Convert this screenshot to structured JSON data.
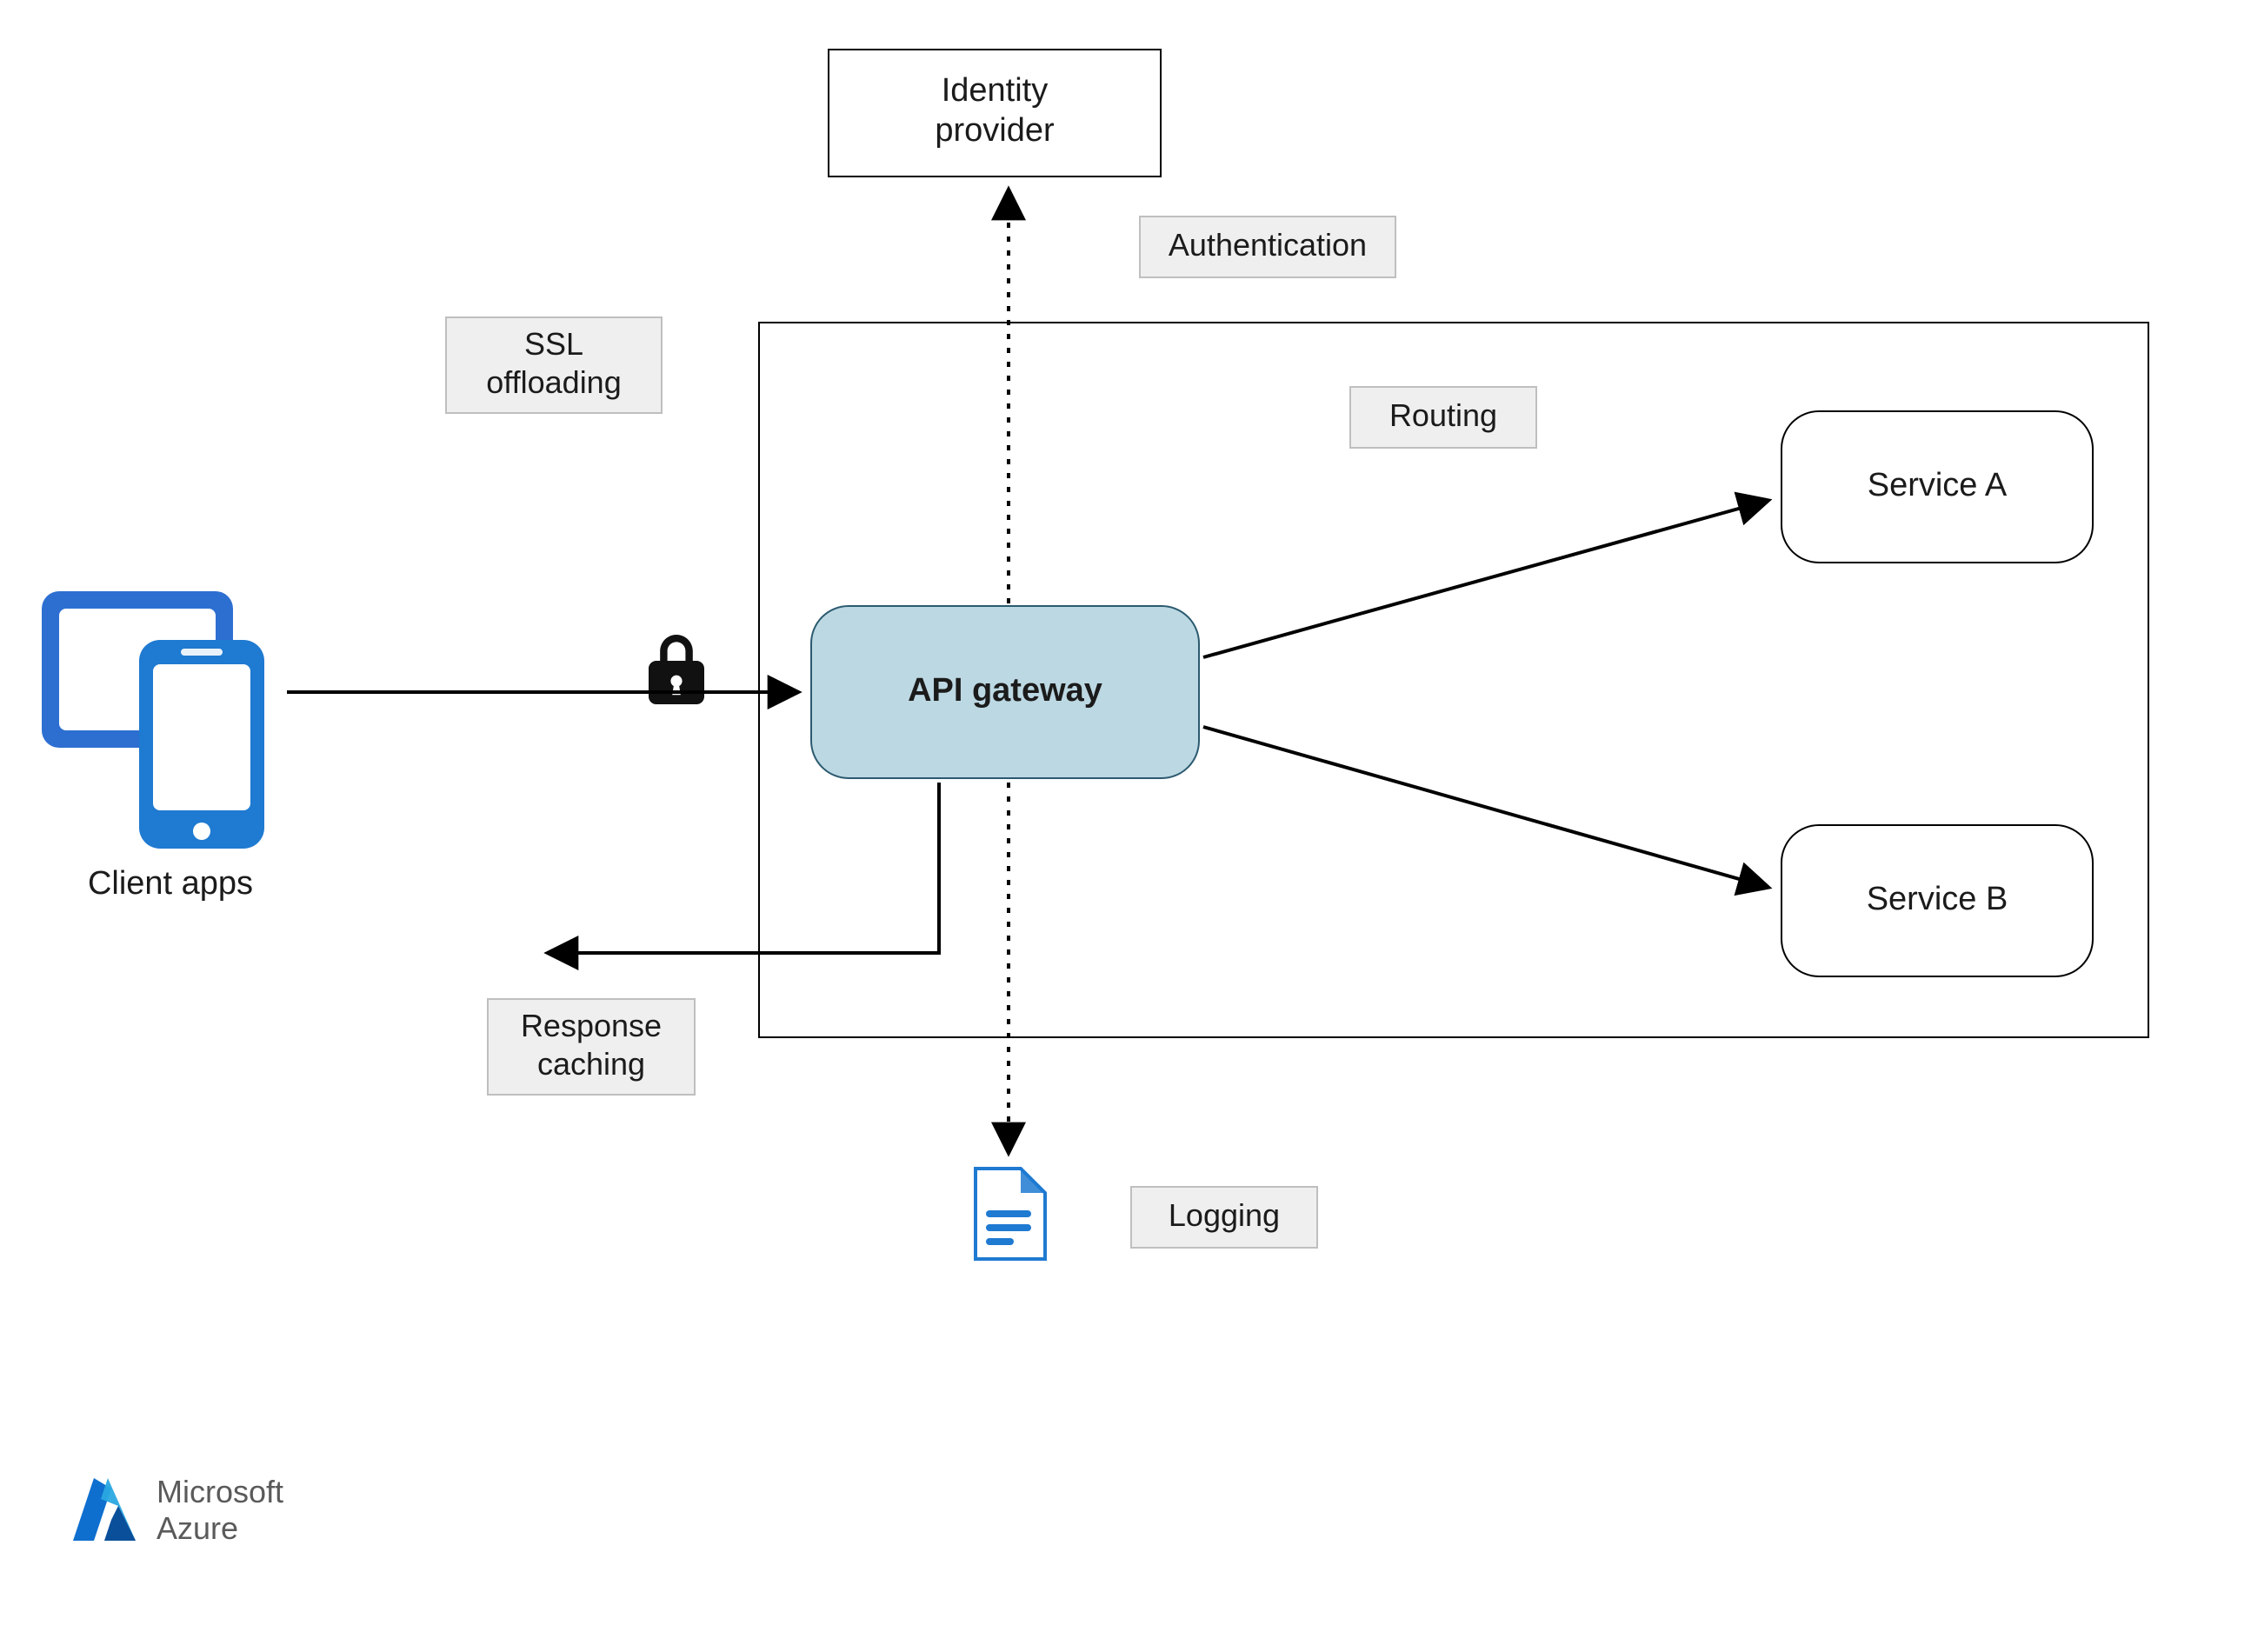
{
  "nodes": {
    "identity_provider": "Identity\nprovider",
    "api_gateway": "API gateway",
    "service_a": "Service A",
    "service_b": "Service B",
    "client_apps": "Client apps"
  },
  "labels": {
    "ssl_offloading": "SSL\noffloading",
    "authentication": "Authentication",
    "routing": "Routing",
    "response_caching": "Response\ncaching",
    "logging": "Logging"
  },
  "icons": {
    "lock": "lock-icon",
    "log_document": "log-document-icon",
    "client_devices": "client-devices-icon",
    "azure": "azure-logo-icon"
  },
  "branding": {
    "line1": "Microsoft",
    "line2": "Azure"
  },
  "colors": {
    "gateway_fill": "#bcd8e3",
    "gateway_stroke": "#2b5a6f",
    "label_fill": "#efefef",
    "label_stroke": "#bfbfbf",
    "azure_blue": "#0f6fcf",
    "azure_cyan": "#2aa8e0"
  }
}
